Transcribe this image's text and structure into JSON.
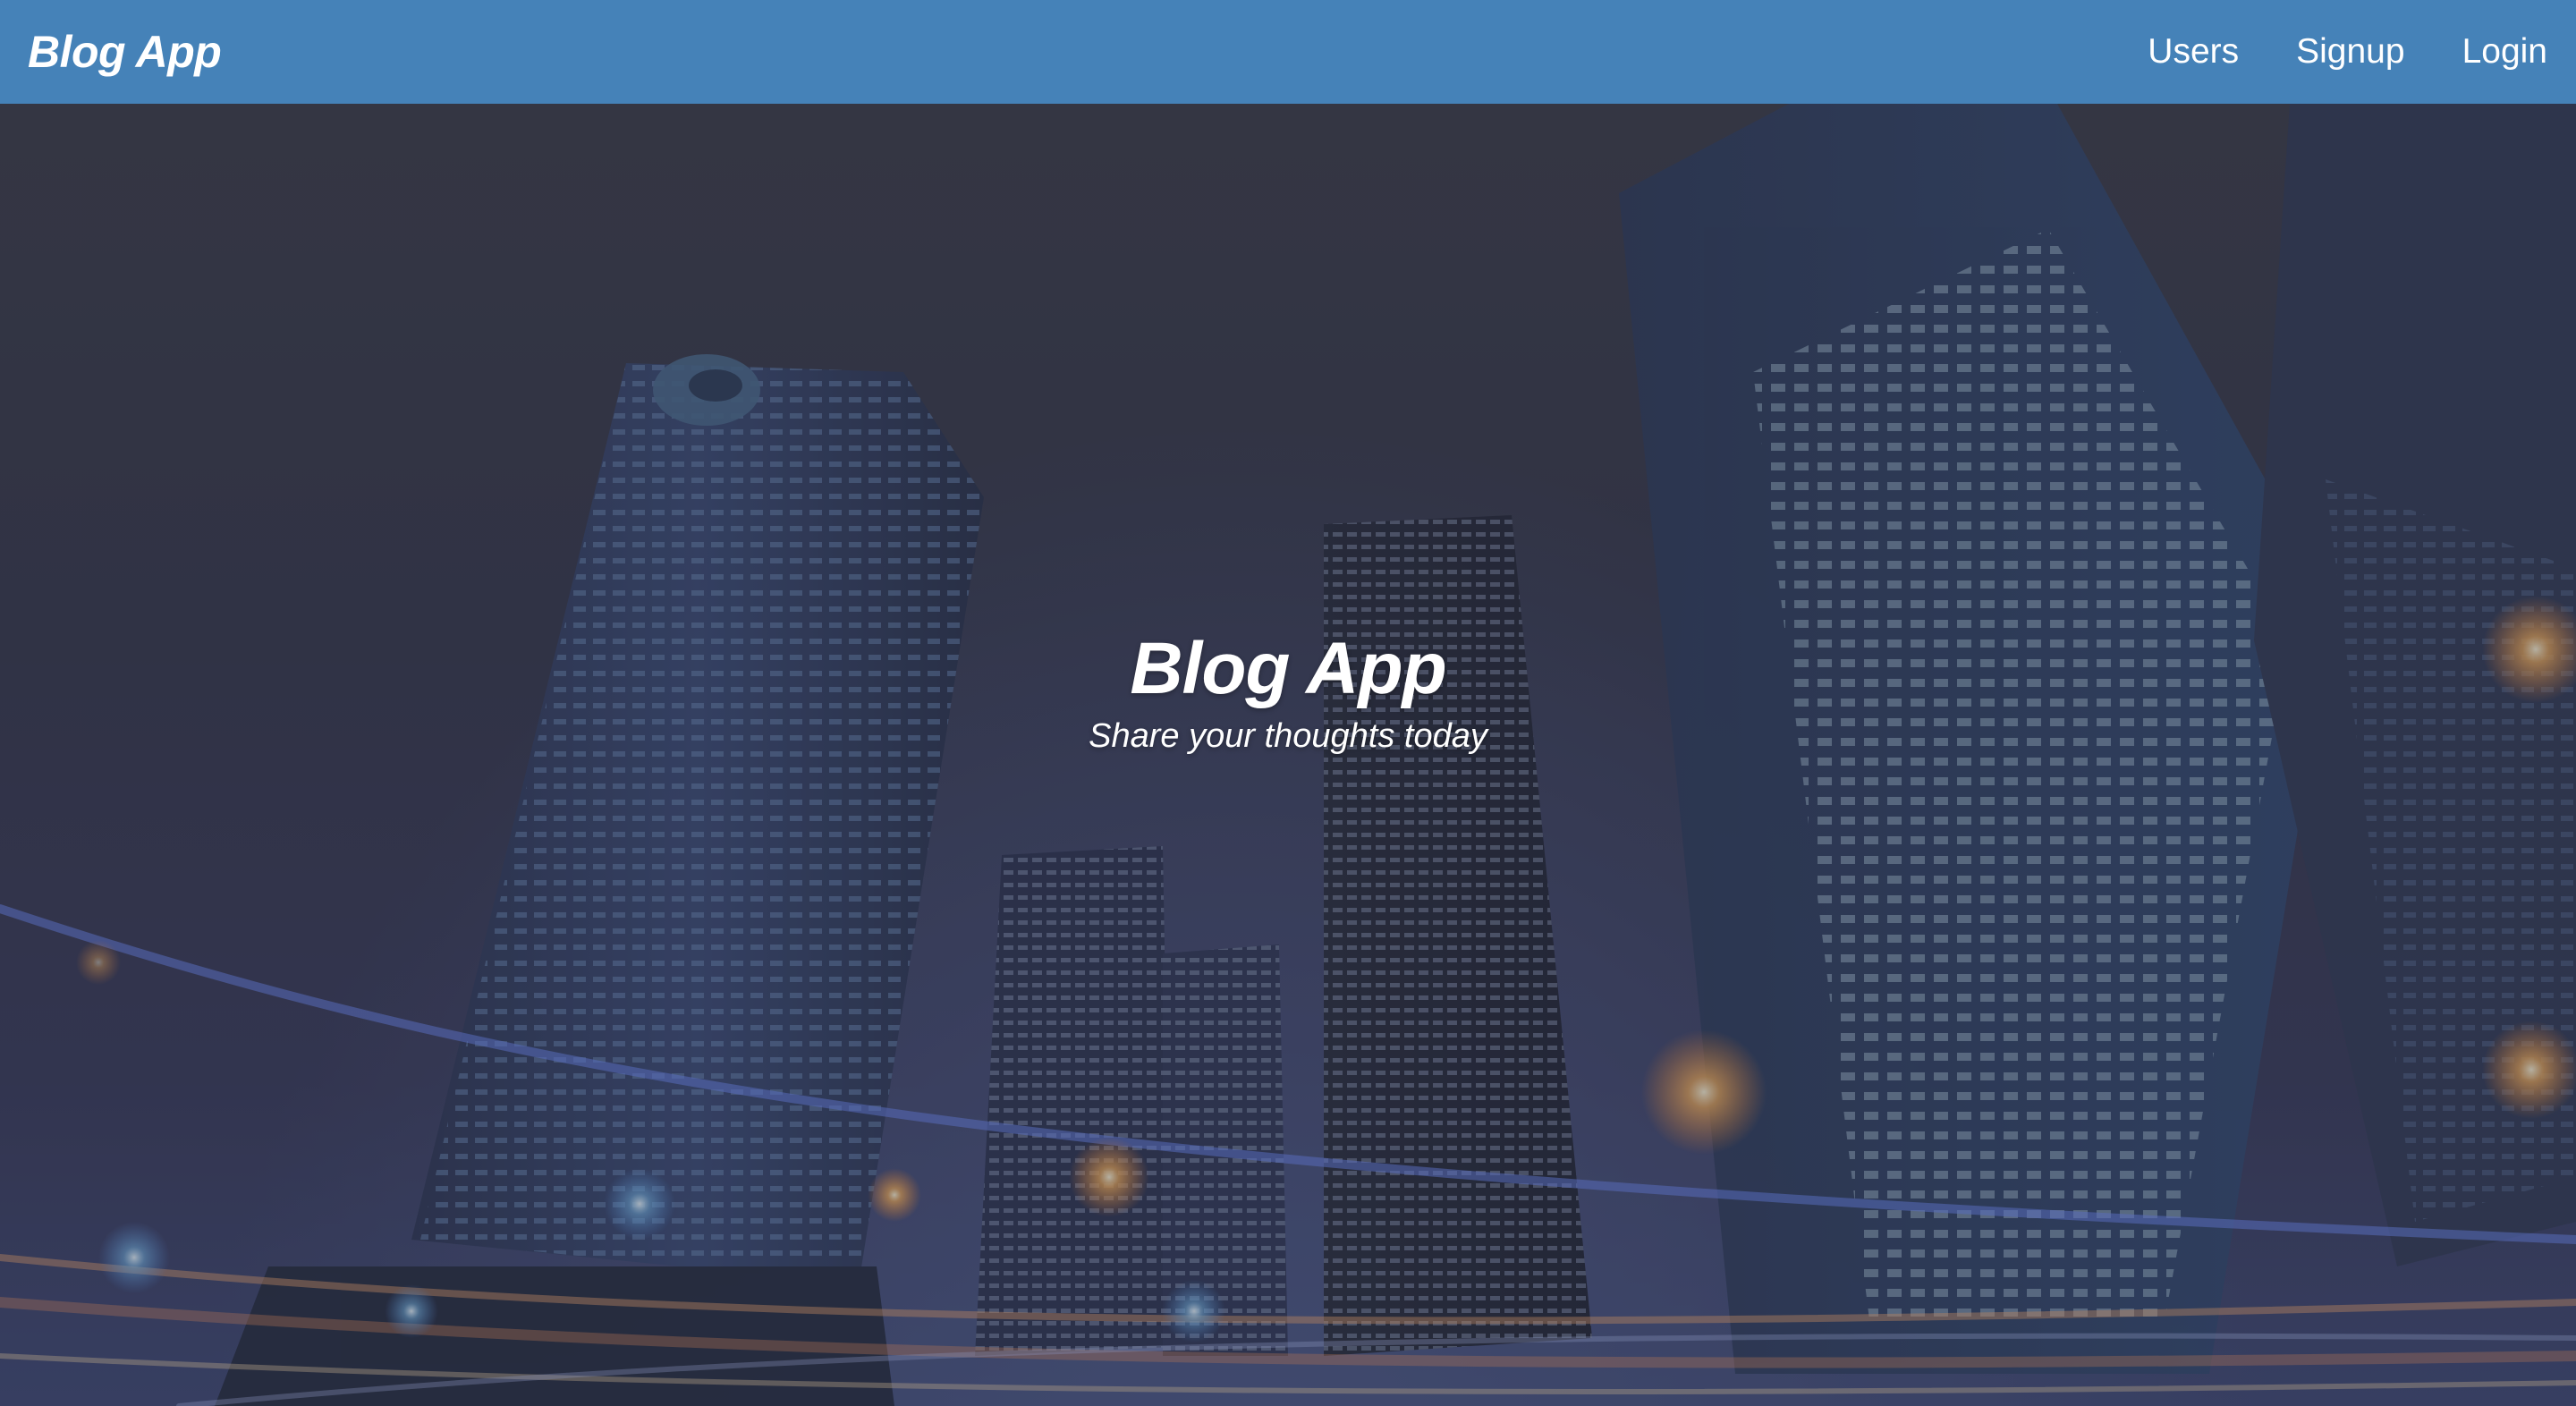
{
  "navbar": {
    "brand": "Blog App",
    "links": [
      {
        "label": "Users"
      },
      {
        "label": "Signup"
      },
      {
        "label": "Login"
      }
    ]
  },
  "hero": {
    "title": "Blog App",
    "subtitle": "Share your thoughts today",
    "background": "night city skyscrapers with light trails",
    "overlay_color": "#2c2d3c"
  },
  "colors": {
    "navbar": "#4582b8",
    "text": "#ffffff"
  }
}
